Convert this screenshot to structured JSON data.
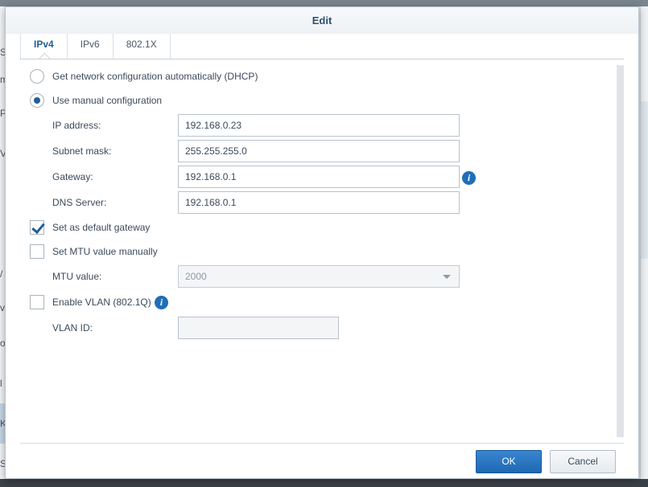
{
  "dialog": {
    "title": "Edit"
  },
  "tabs": [
    {
      "label": "IPv4",
      "active": true
    },
    {
      "label": "IPv6",
      "active": false
    },
    {
      "label": "802.1X",
      "active": false
    }
  ],
  "ipv4": {
    "dhcp_option": {
      "label": "Get network configuration automatically (DHCP)",
      "selected": false
    },
    "manual_option": {
      "label": "Use manual configuration",
      "selected": true
    },
    "ip_address": {
      "label": "IP address:",
      "value": "192.168.0.23"
    },
    "subnet_mask": {
      "label": "Subnet mask:",
      "value": "255.255.255.0"
    },
    "gateway": {
      "label": "Gateway:",
      "value": "192.168.0.1"
    },
    "dns_server": {
      "label": "DNS Server:",
      "value": "192.168.0.1"
    },
    "default_gateway": {
      "label": "Set as default gateway",
      "checked": true
    },
    "mtu_manual": {
      "label": "Set MTU value manually",
      "checked": false
    },
    "mtu_value": {
      "label": "MTU value:",
      "value": "2000",
      "disabled": true
    },
    "vlan": {
      "label": "Enable VLAN (802.1Q)",
      "checked": false
    },
    "vlan_id": {
      "label": "VLAN ID:",
      "value": "",
      "disabled": true
    }
  },
  "footer": {
    "ok_label": "OK",
    "cancel_label": "Cancel"
  },
  "background_fragments": [
    "Se",
    "m",
    "P",
    "V",
    "/",
    "vi",
    "o",
    "l",
    "K",
    "S"
  ],
  "colors": {
    "accent": "#1f67b3",
    "title": "#2f4f6f",
    "info_icon": "#1f6eb8"
  },
  "icons": {
    "info": "info-icon",
    "dropdown": "chevron-down-icon",
    "check": "checkmark-icon"
  }
}
